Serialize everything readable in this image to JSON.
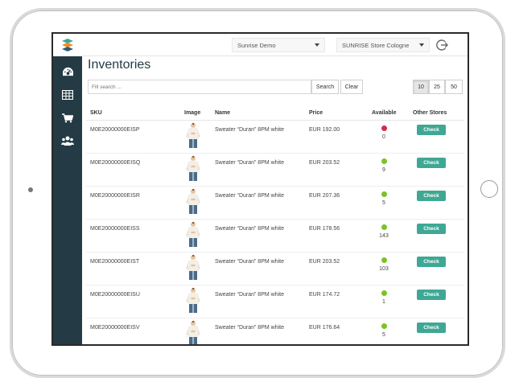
{
  "topbar": {
    "project_select": "Sunrise Demo",
    "store_select": "SUNRISE Store Cologne"
  },
  "page": {
    "title": "Inventories",
    "search_placeholder": "Fill search ...",
    "search_label": "Search",
    "clear_label": "Clear",
    "page_sizes": [
      "10",
      "25",
      "50"
    ],
    "active_page_size": "10"
  },
  "table": {
    "headers": {
      "sku": "SKU",
      "image": "Image",
      "name": "Name",
      "price": "Price",
      "available": "Available",
      "other_stores": "Other Stores"
    },
    "rows": [
      {
        "sku": "M0E20000000EISP",
        "name": "Sweater “Duran” 8PM white",
        "price": "EUR 192.00",
        "available": "0",
        "status": "out",
        "action": "Check"
      },
      {
        "sku": "M0E20000000EISQ",
        "name": "Sweater “Duran” 8PM white",
        "price": "EUR 203.52",
        "available": "9",
        "status": "in",
        "action": "Check"
      },
      {
        "sku": "M0E20000000EISR",
        "name": "Sweater “Duran” 8PM white",
        "price": "EUR 207.36",
        "available": "5",
        "status": "in",
        "action": "Check"
      },
      {
        "sku": "M0E20000000EISS",
        "name": "Sweater “Duran” 8PM white",
        "price": "EUR 178.56",
        "available": "143",
        "status": "in",
        "action": "Check"
      },
      {
        "sku": "M0E20000000EIST",
        "name": "Sweater “Duran” 8PM white",
        "price": "EUR 203.52",
        "available": "103",
        "status": "in",
        "action": "Check"
      },
      {
        "sku": "M0E20000000EISU",
        "name": "Sweater “Duran” 8PM white",
        "price": "EUR 174.72",
        "available": "1",
        "status": "in",
        "action": "Check"
      },
      {
        "sku": "M0E20000000EISV",
        "name": "Sweater “Duran” 8PM white",
        "price": "EUR 176.64",
        "available": "5",
        "status": "in",
        "action": "Check"
      }
    ]
  },
  "colors": {
    "sidebar": "#243b45",
    "accent": "#3fa894",
    "in_stock": "#7cc226",
    "out_of_stock": "#d62b4b"
  },
  "icons": {
    "sidebar": [
      "dashboard-icon",
      "table-icon",
      "cart-icon",
      "users-icon"
    ],
    "topbar": [
      "logout-icon"
    ]
  }
}
